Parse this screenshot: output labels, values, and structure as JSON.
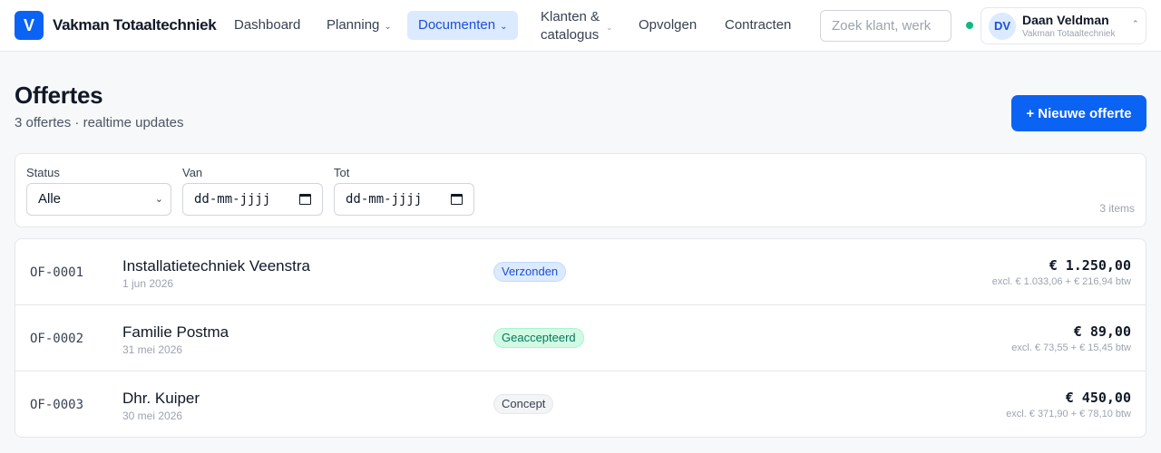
{
  "app": {
    "logo_letter": "V",
    "brand": "Vakman Totaaltechniek"
  },
  "nav": {
    "items": [
      {
        "label": "Dashboard"
      },
      {
        "label": "Planning",
        "icon": "chevron-down-icon"
      },
      {
        "label": "Documenten",
        "icon": "chevron-down-icon",
        "active": true
      },
      {
        "label_line1": "Klanten &",
        "label_line2": "catalogus",
        "icon": "chevron-down-icon"
      },
      {
        "label": "Opvolgen"
      },
      {
        "label": "Contracten"
      }
    ]
  },
  "search": {
    "placeholder": "Zoek klant, werk"
  },
  "user": {
    "initials": "DV",
    "name": "Daan Veldman",
    "org": "Vakman Totaaltechniek",
    "status_color": "#10b981"
  },
  "page": {
    "title": "Offertes",
    "subtitle": "3 offertes · realtime updates",
    "new_button": "+ Nieuwe offerte"
  },
  "filters": {
    "status_label": "Status",
    "status_value": "Alle",
    "from_label": "Van",
    "from_value": "dd-mm-jjjj",
    "to_label": "Tot",
    "to_value": "dd-mm-jjjj",
    "count": "3 items"
  },
  "quotes": [
    {
      "id": "OF-0001",
      "client": "Installatietechniek Veenstra",
      "date": "1 jun 2026",
      "status": "Verzonden",
      "amount": "€ 1.250,00",
      "vat": "excl. € 1.033,06 + € 216,94 btw"
    },
    {
      "id": "OF-0002",
      "client": "Familie Postma",
      "date": "31 mei 2026",
      "status": "Geaccepteerd",
      "amount": "€ 89,00",
      "vat": "excl. € 73,55 + € 15,45 btw"
    },
    {
      "id": "OF-0003",
      "client": "Dhr. Kuiper",
      "date": "30 mei 2026",
      "status": "Concept",
      "amount": "€ 450,00",
      "vat": "excl. € 371,90 + € 78,10 btw"
    }
  ],
  "colors": {
    "accent": "#0b63f3",
    "status_sent": "#1d4ed8",
    "status_accepted": "#047857",
    "status_draft": "#374151"
  }
}
